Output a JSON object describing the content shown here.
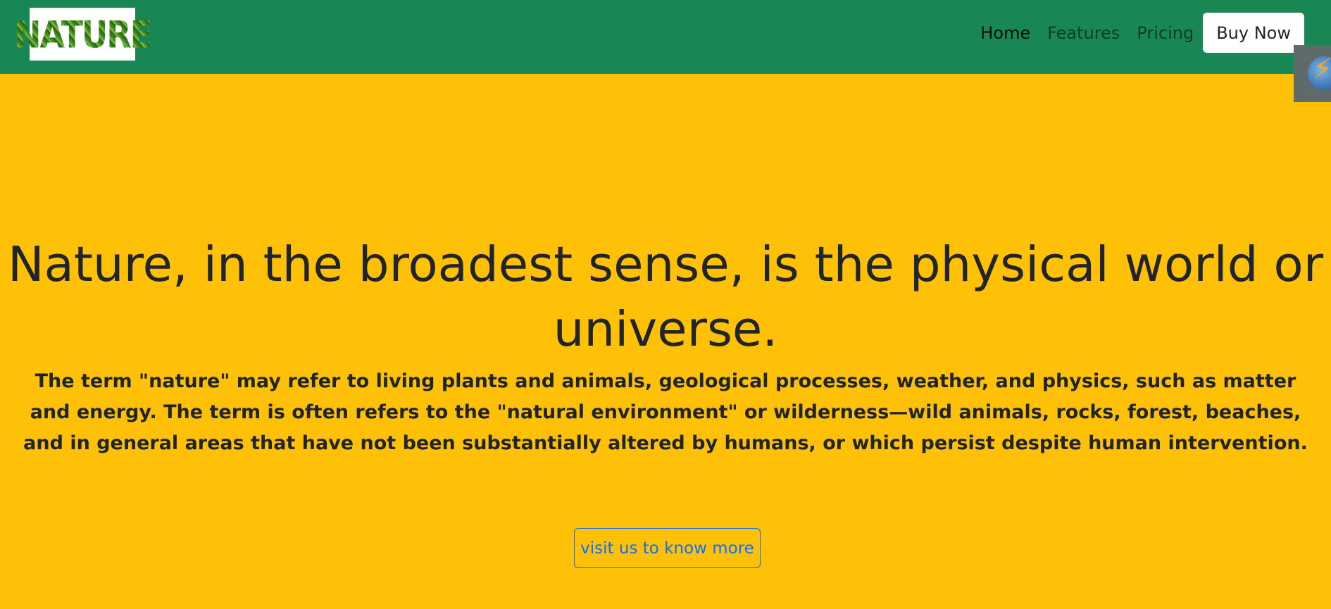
{
  "navbar": {
    "logo_text": "NATURE",
    "links": [
      {
        "label": "Home",
        "active": true
      },
      {
        "label": "Features",
        "active": false
      },
      {
        "label": "Pricing",
        "active": false
      }
    ],
    "buy_label": "Buy Now",
    "bg_color": "#198754"
  },
  "side_widget": {
    "icon": "lightning-icon"
  },
  "hero": {
    "title": "Nature, in the broadest sense, is the physical world or universe.",
    "text": "The term \"nature\" may refer to living plants and animals, geological processes, weather, and physics, such as matter and energy. The term is often refers to the \"natural environment\" or wilderness—wild animals, rocks, forest, beaches, and in general areas that have not been substantially altered by humans, or which persist despite human intervention.",
    "cta_label": "visit us to know more",
    "bg_color": "#FFC107"
  }
}
